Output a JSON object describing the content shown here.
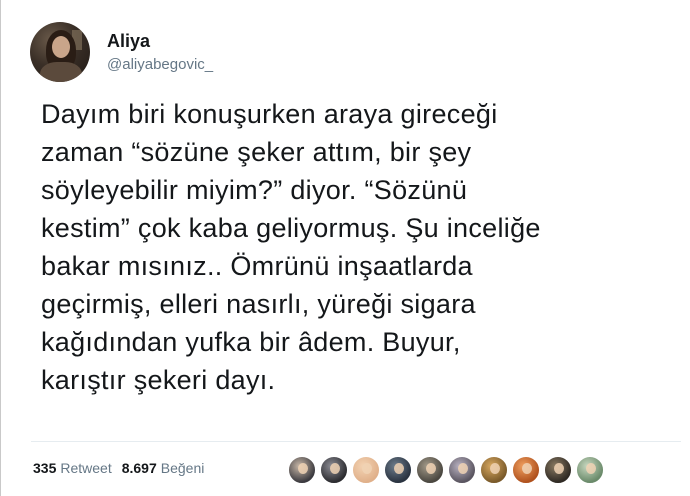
{
  "user": {
    "display_name": "Aliya",
    "handle": "@aliyabegovic_"
  },
  "tweet": {
    "text": "Dayım biri konuşurken araya gireceği\nzaman “sözüne şeker attım, bir şey\nsöyleyebilir miyim?” diyor. “Sözünü\nkestim” çok kaba geliyormuş. Şu inceliğe\nbakar mısınız.. Ömrünü inşaatlarda\ngeçirmiş, elleri nasırlı, yüreği sigara\nkağıdından yufka bir âdem. Buyur,\nkarıştır şekeri dayı."
  },
  "stats": {
    "retweets": "335",
    "retweets_label": "Retweet",
    "likes": "8.697",
    "likes_label": "Beğeni"
  },
  "likers": [
    {
      "name": "liker-avatar-1",
      "color": "#3b3a3f",
      "accent": "#c9b8a8"
    },
    {
      "name": "liker-avatar-2",
      "color": "#2c2c30",
      "accent": "#8d8d95"
    },
    {
      "name": "liker-avatar-3",
      "color": "#e0b08a",
      "accent": "#f3d3b3"
    },
    {
      "name": "liker-avatar-4",
      "color": "#2a3340",
      "accent": "#6d7d8d"
    },
    {
      "name": "liker-avatar-5",
      "color": "#4a4740",
      "accent": "#a49b8a"
    },
    {
      "name": "liker-avatar-6",
      "color": "#5a5560",
      "accent": "#b9b2c2"
    },
    {
      "name": "liker-avatar-7",
      "color": "#7a5a2a",
      "accent": "#d8a860"
    },
    {
      "name": "liker-avatar-8",
      "color": "#b0521e",
      "accent": "#f0a060"
    },
    {
      "name": "liker-avatar-9",
      "color": "#2f2a24",
      "accent": "#8a7a62"
    },
    {
      "name": "liker-avatar-10",
      "color": "#6a8a6a",
      "accent": "#c8d8c0"
    }
  ]
}
